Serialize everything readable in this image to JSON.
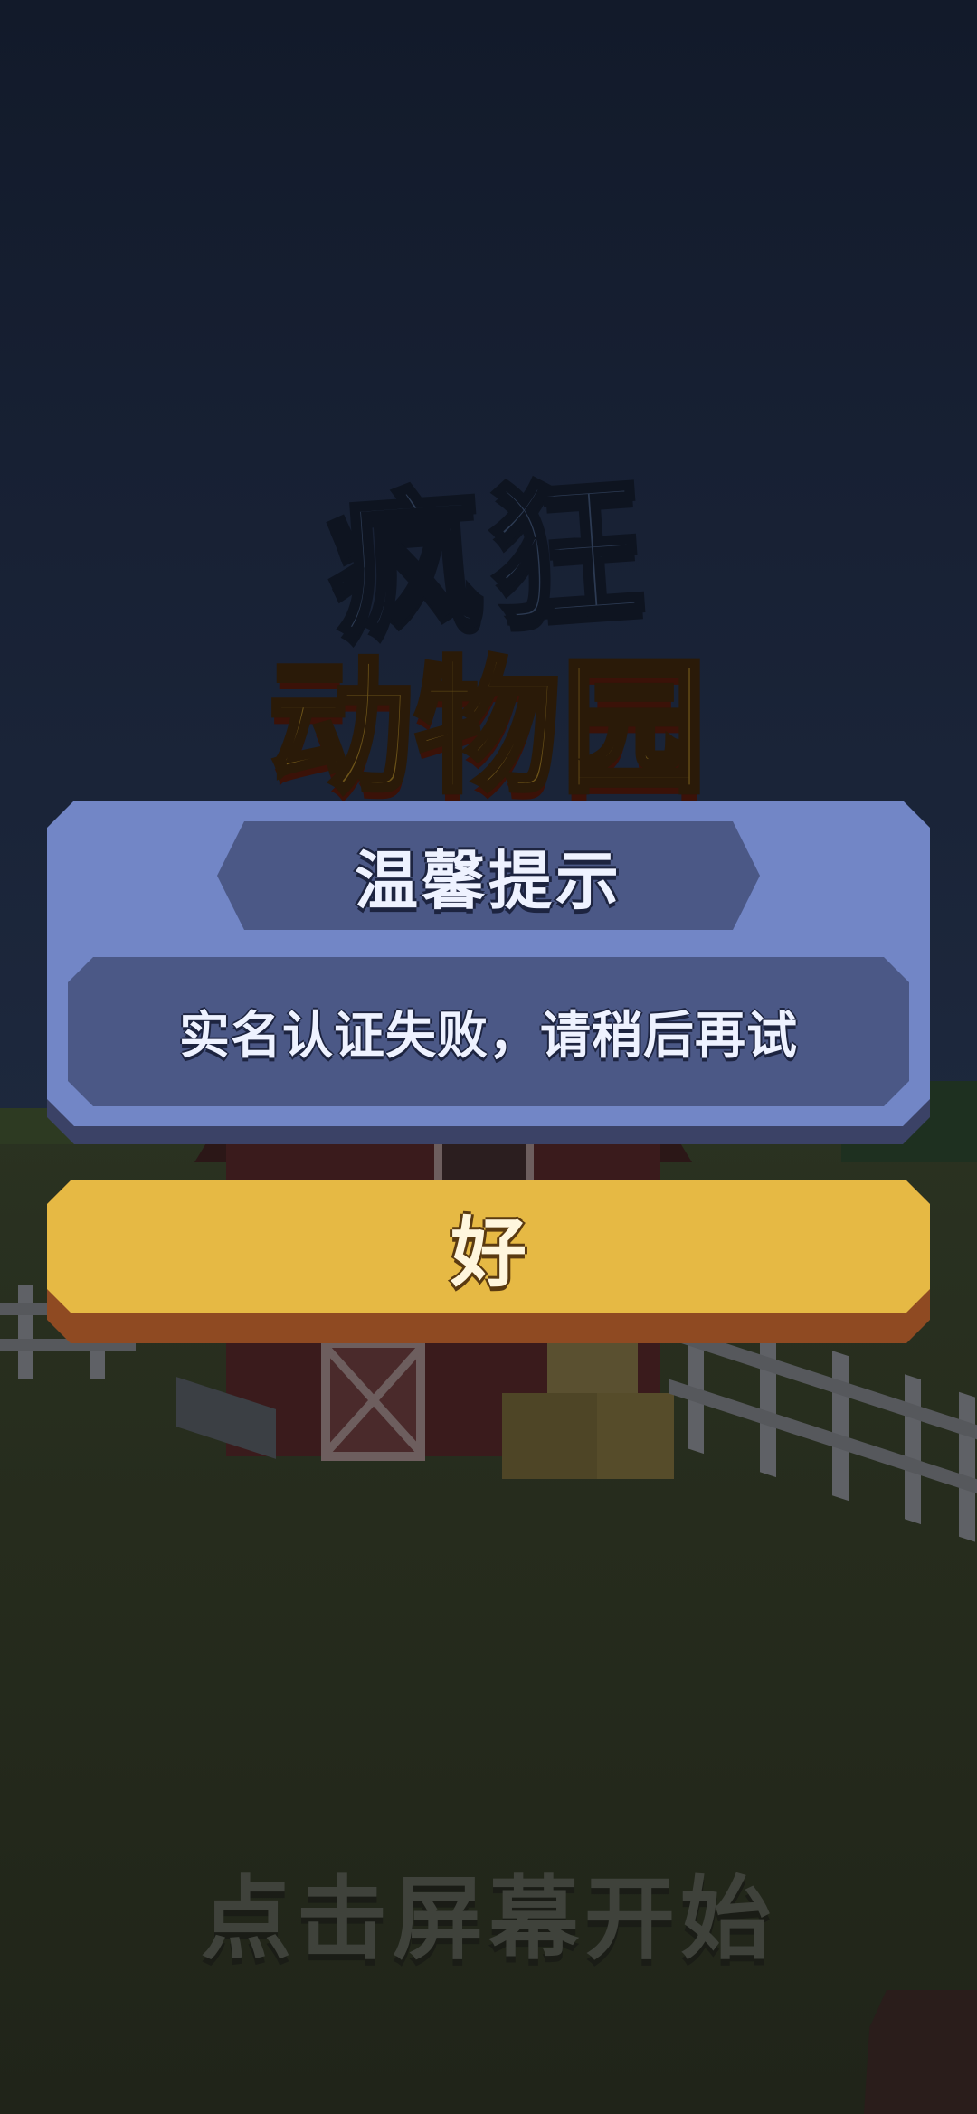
{
  "game": {
    "logo_line1": "疯狂",
    "logo_line2": "动物园",
    "tap_to_start": "点击屏幕开始"
  },
  "dialog": {
    "title": "温馨提示",
    "message": "实名认证失败，请稍后再试",
    "ok_label": "好"
  },
  "colors": {
    "dialog_panel": "#7286c6",
    "dialog_plate": "#4b5886",
    "ok_button": "#e6b944",
    "ok_button_edge": "#8f4a22",
    "logo_top": "#2c3a52",
    "logo_bottom": "#6d5419"
  }
}
